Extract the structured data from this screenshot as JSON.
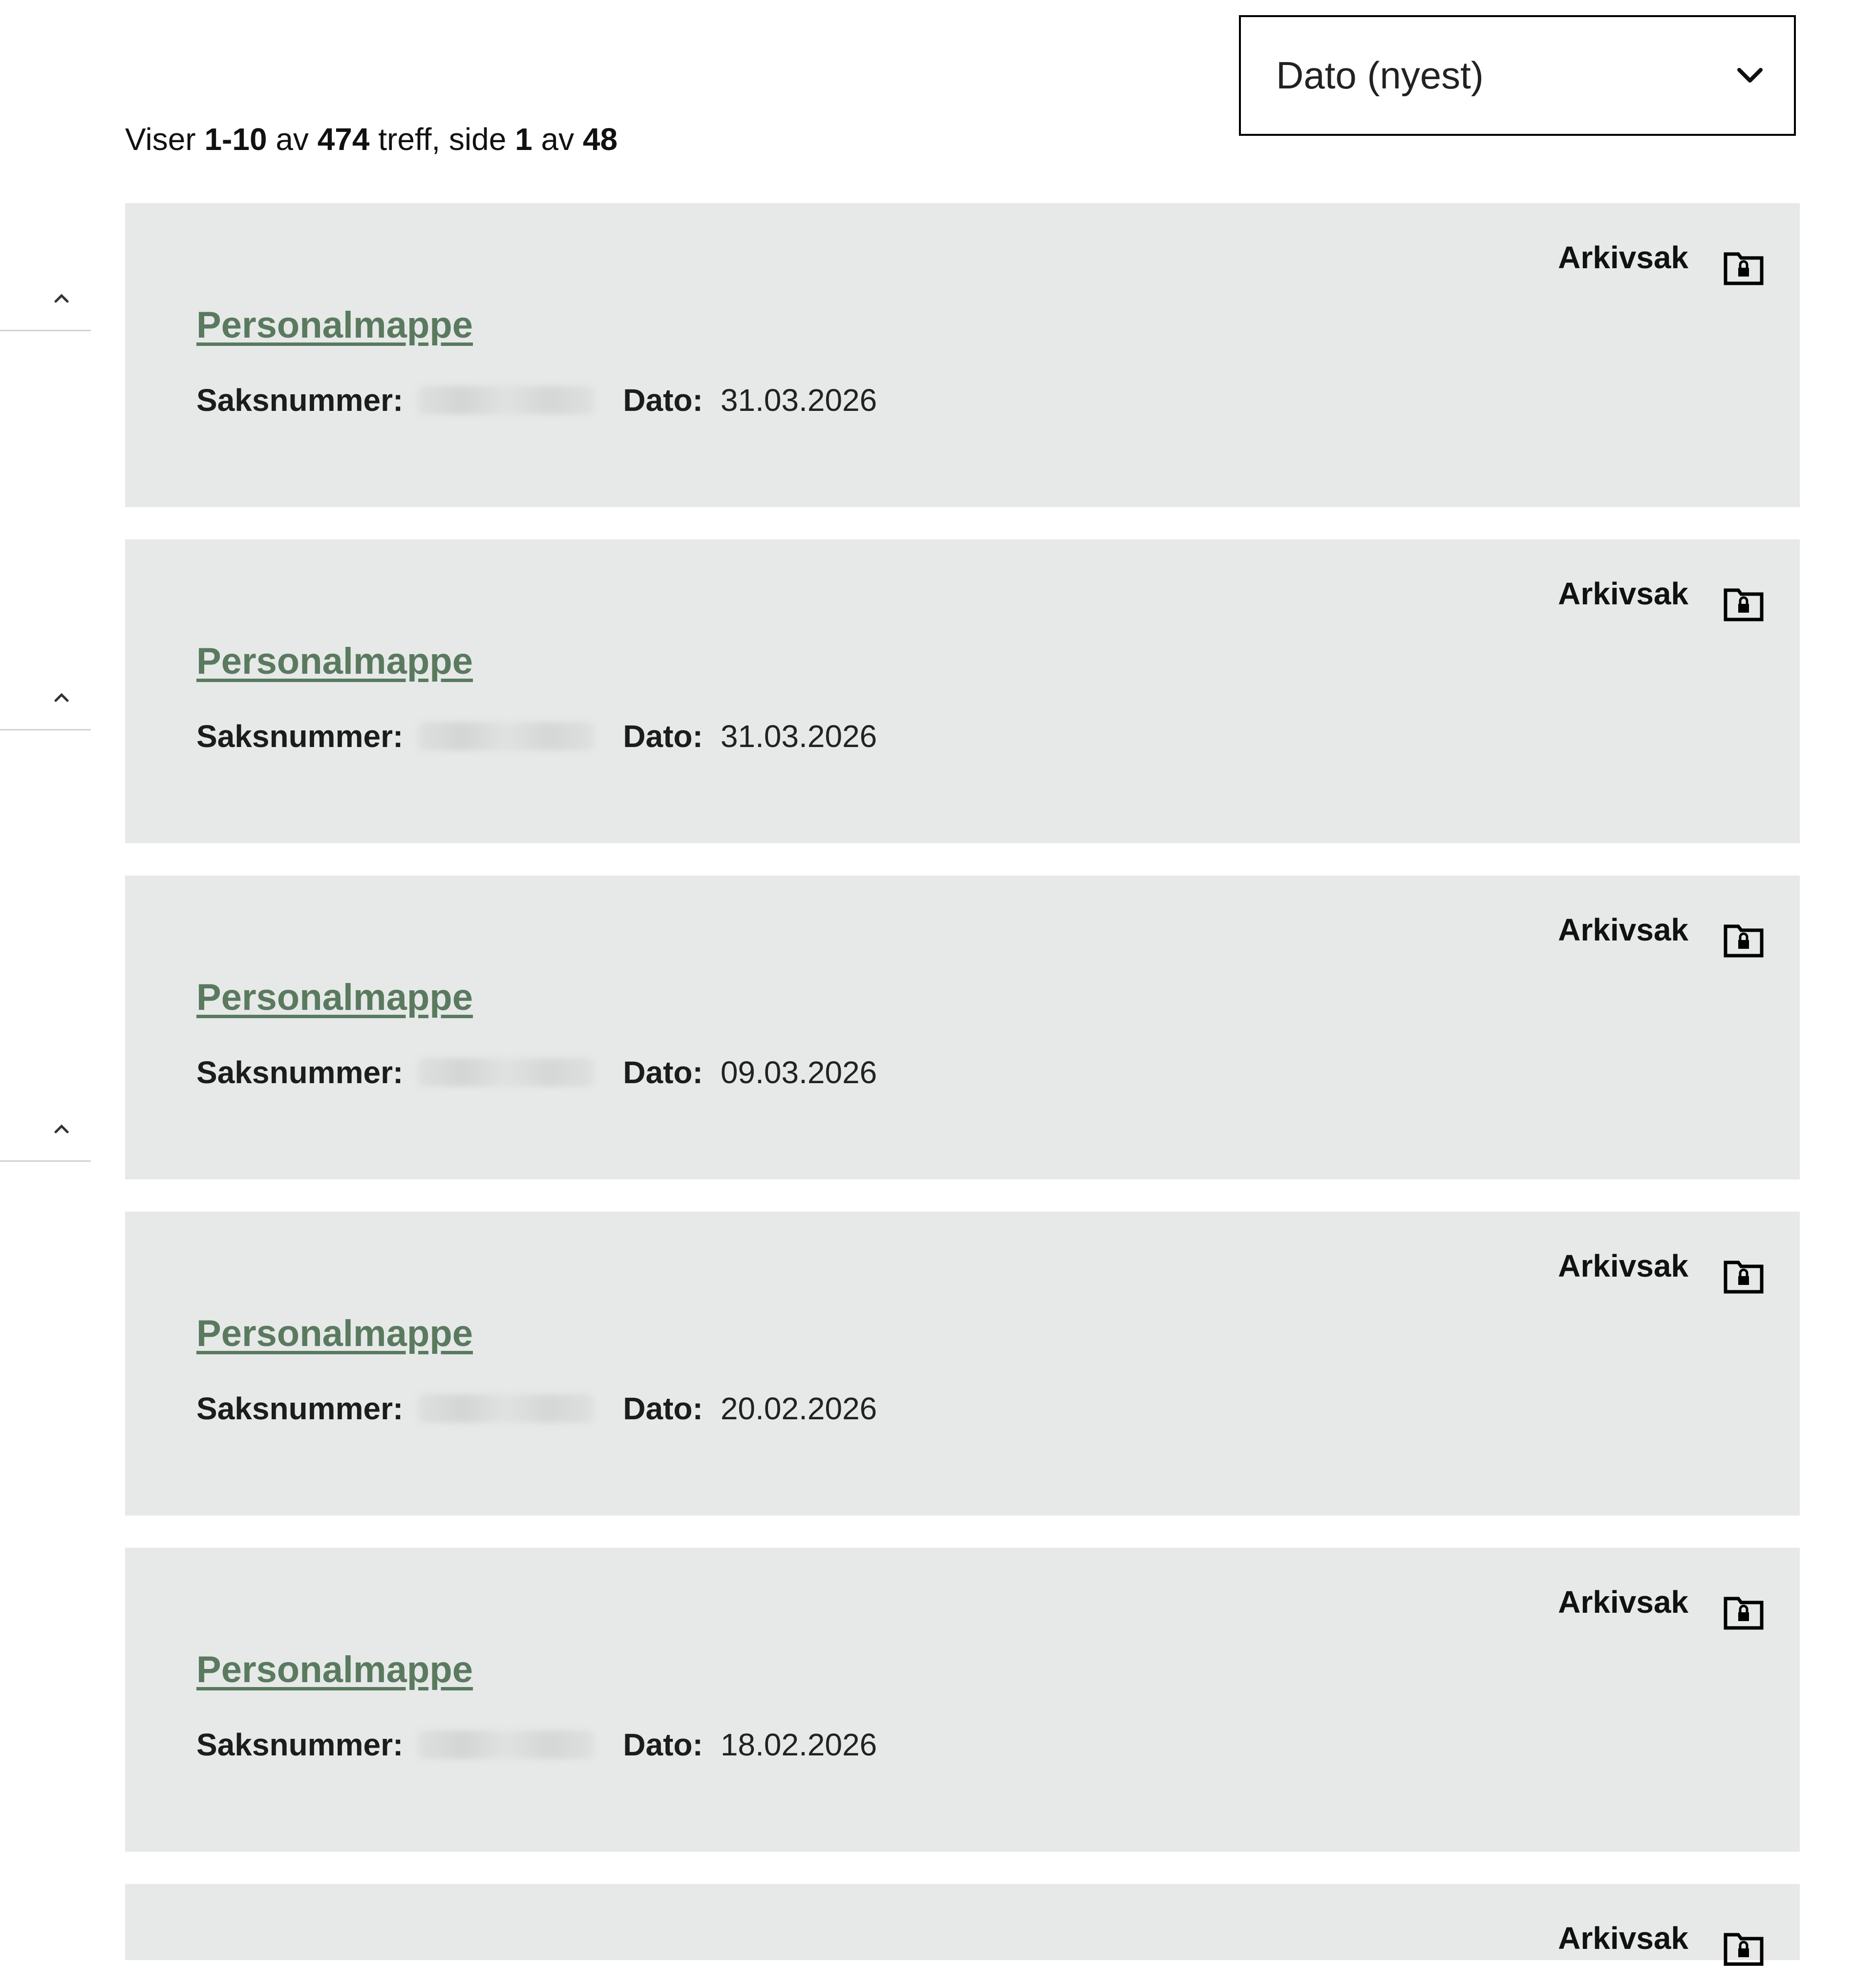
{
  "sort": {
    "selected": "Dato (nyest)"
  },
  "summary": {
    "prefix": "Viser",
    "range": "1-10",
    "of1": "av",
    "total": "474",
    "hits": "treff, side",
    "page": "1",
    "of2": "av",
    "pages": "48"
  },
  "labels": {
    "case_number": "Saksnummer:",
    "date": "Dato:"
  },
  "results": [
    {
      "type": "Arkivsak",
      "title": "Personalmappe",
      "date": "31.03.2026"
    },
    {
      "type": "Arkivsak",
      "title": "Personalmappe",
      "date": "31.03.2026"
    },
    {
      "type": "Arkivsak",
      "title": "Personalmappe",
      "date": "09.03.2026"
    },
    {
      "type": "Arkivsak",
      "title": "Personalmappe",
      "date": "20.02.2026"
    },
    {
      "type": "Arkivsak",
      "title": "Personalmappe",
      "date": "18.02.2026"
    },
    {
      "type": "Arkivsak"
    }
  ],
  "icons": {
    "card": "folder-lock-icon",
    "sort": "chevron-down-icon",
    "side": "chevron-up-icon"
  },
  "colors": {
    "card_bg": "#e6e9e8",
    "link": "#5a7a5f"
  }
}
